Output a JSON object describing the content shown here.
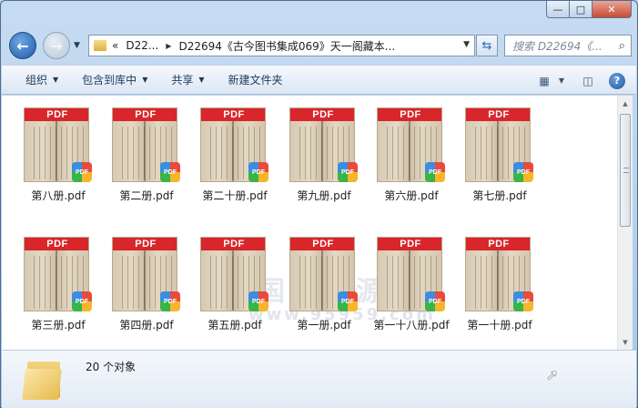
{
  "window": {
    "caption_buttons": {
      "minimize": "—",
      "maximize": "□",
      "close": "✕"
    }
  },
  "nav": {
    "back_icon": "arrow-left-icon",
    "forward_icon": "arrow-right-icon",
    "breadcrumb_prefix": "«",
    "crumb_1": "D22...",
    "crumb_2": "D22694《古今图书集成069》天一阁藏本...",
    "search_placeholder": "搜索 D22694《...",
    "refresh_glyph": "⇆",
    "search_glyph": "⌕"
  },
  "toolbar": {
    "organize": "组织",
    "include_library": "包含到库中",
    "share": "共享",
    "new_folder": "新建文件夹",
    "help_glyph": "?"
  },
  "files": [
    {
      "name": "第八册.pdf"
    },
    {
      "name": "第二册.pdf"
    },
    {
      "name": "第二十册.pdf"
    },
    {
      "name": "第九册.pdf"
    },
    {
      "name": "第六册.pdf"
    },
    {
      "name": "第七册.pdf"
    },
    {
      "name": "第三册.pdf"
    },
    {
      "name": "第四册.pdf"
    },
    {
      "name": "第五册.pdf"
    },
    {
      "name": "第一册.pdf"
    },
    {
      "name": "第一十八册.pdf"
    },
    {
      "name": "第一十册.pdf"
    }
  ],
  "thumbnail": {
    "banner": "PDF",
    "badge": "PDF"
  },
  "watermark": {
    "line1": "国学资源网",
    "line2": "www.95959.com"
  },
  "status": {
    "count": "20 个对象"
  },
  "colors": {
    "pdf_red": "#d8262b",
    "accent": "#1d5aa8"
  }
}
